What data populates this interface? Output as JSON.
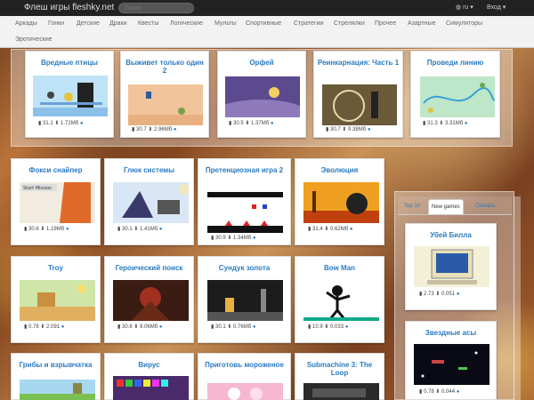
{
  "site": {
    "brand": "Флеш игры fleshky.net",
    "search_placeholder": "Поиск",
    "lang": "ru",
    "login": "Вход"
  },
  "categories": [
    "Аркады",
    "Гонки",
    "Детские",
    "Драки",
    "Квесты",
    "Логические",
    "Мульты",
    "Спортивные",
    "Стратегии",
    "Стрелялки",
    "Прочее",
    "Азартные",
    "Симуляторы",
    "Эротические"
  ],
  "games": [
    {
      "title": "Вредные птицы",
      "rating": "31.1",
      "downloads": "1.72Мб"
    },
    {
      "title": "Выживет только один 2",
      "rating": "30.7",
      "downloads": "2.96Мб"
    },
    {
      "title": "Орфей",
      "rating": "30.5",
      "downloads": "1.37Мб"
    },
    {
      "title": "Реинкарнация: Часть 1",
      "rating": "30.7",
      "downloads": "9.38Мб"
    },
    {
      "title": "Проведи линию",
      "rating": "31.3",
      "downloads": "3.31Мб"
    },
    {
      "title": "Фокси снайпер",
      "rating": "30.6",
      "downloads": "1.19Мб"
    },
    {
      "title": "Глюк системы",
      "rating": "30.1",
      "downloads": "1.41Мб"
    },
    {
      "title": "Претенциозная игра 2",
      "rating": "30.9",
      "downloads": "1.34Мб"
    },
    {
      "title": "Эволюция",
      "rating": "31.4",
      "downloads": "0.62Мб"
    },
    {
      "title": "Troy",
      "rating": "0.78",
      "downloads": "2.091"
    },
    {
      "title": "Героический поиск",
      "rating": "30.6",
      "downloads": "9.06Мб"
    },
    {
      "title": "Сундук золота",
      "rating": "30.1",
      "downloads": "0.76Мб"
    },
    {
      "title": "Bow Man",
      "rating": "10.9",
      "downloads": "0.033"
    },
    {
      "title": "Грибы и взрывчатка",
      "rating": "",
      "downloads": ""
    },
    {
      "title": "Вирус",
      "rating": "",
      "downloads": ""
    },
    {
      "title": "Приготовь мороженое",
      "rating": "",
      "downloads": ""
    },
    {
      "title": "Submachine 3: The Loop",
      "rating": "",
      "downloads": ""
    }
  ],
  "sidebar": {
    "tabs": [
      "Top 10",
      "New games",
      "Связать"
    ],
    "items": [
      {
        "title": "Убей Билла",
        "rating": "2.73",
        "downloads": "0.051"
      },
      {
        "title": "Звездные асы",
        "rating": "0.78",
        "downloads": "0.044"
      }
    ]
  },
  "thumb_text": {
    "foxy": "Start Mission"
  },
  "icons": {
    "rating": "bars-icon",
    "download": "download-icon",
    "comments": "comment-icon"
  }
}
